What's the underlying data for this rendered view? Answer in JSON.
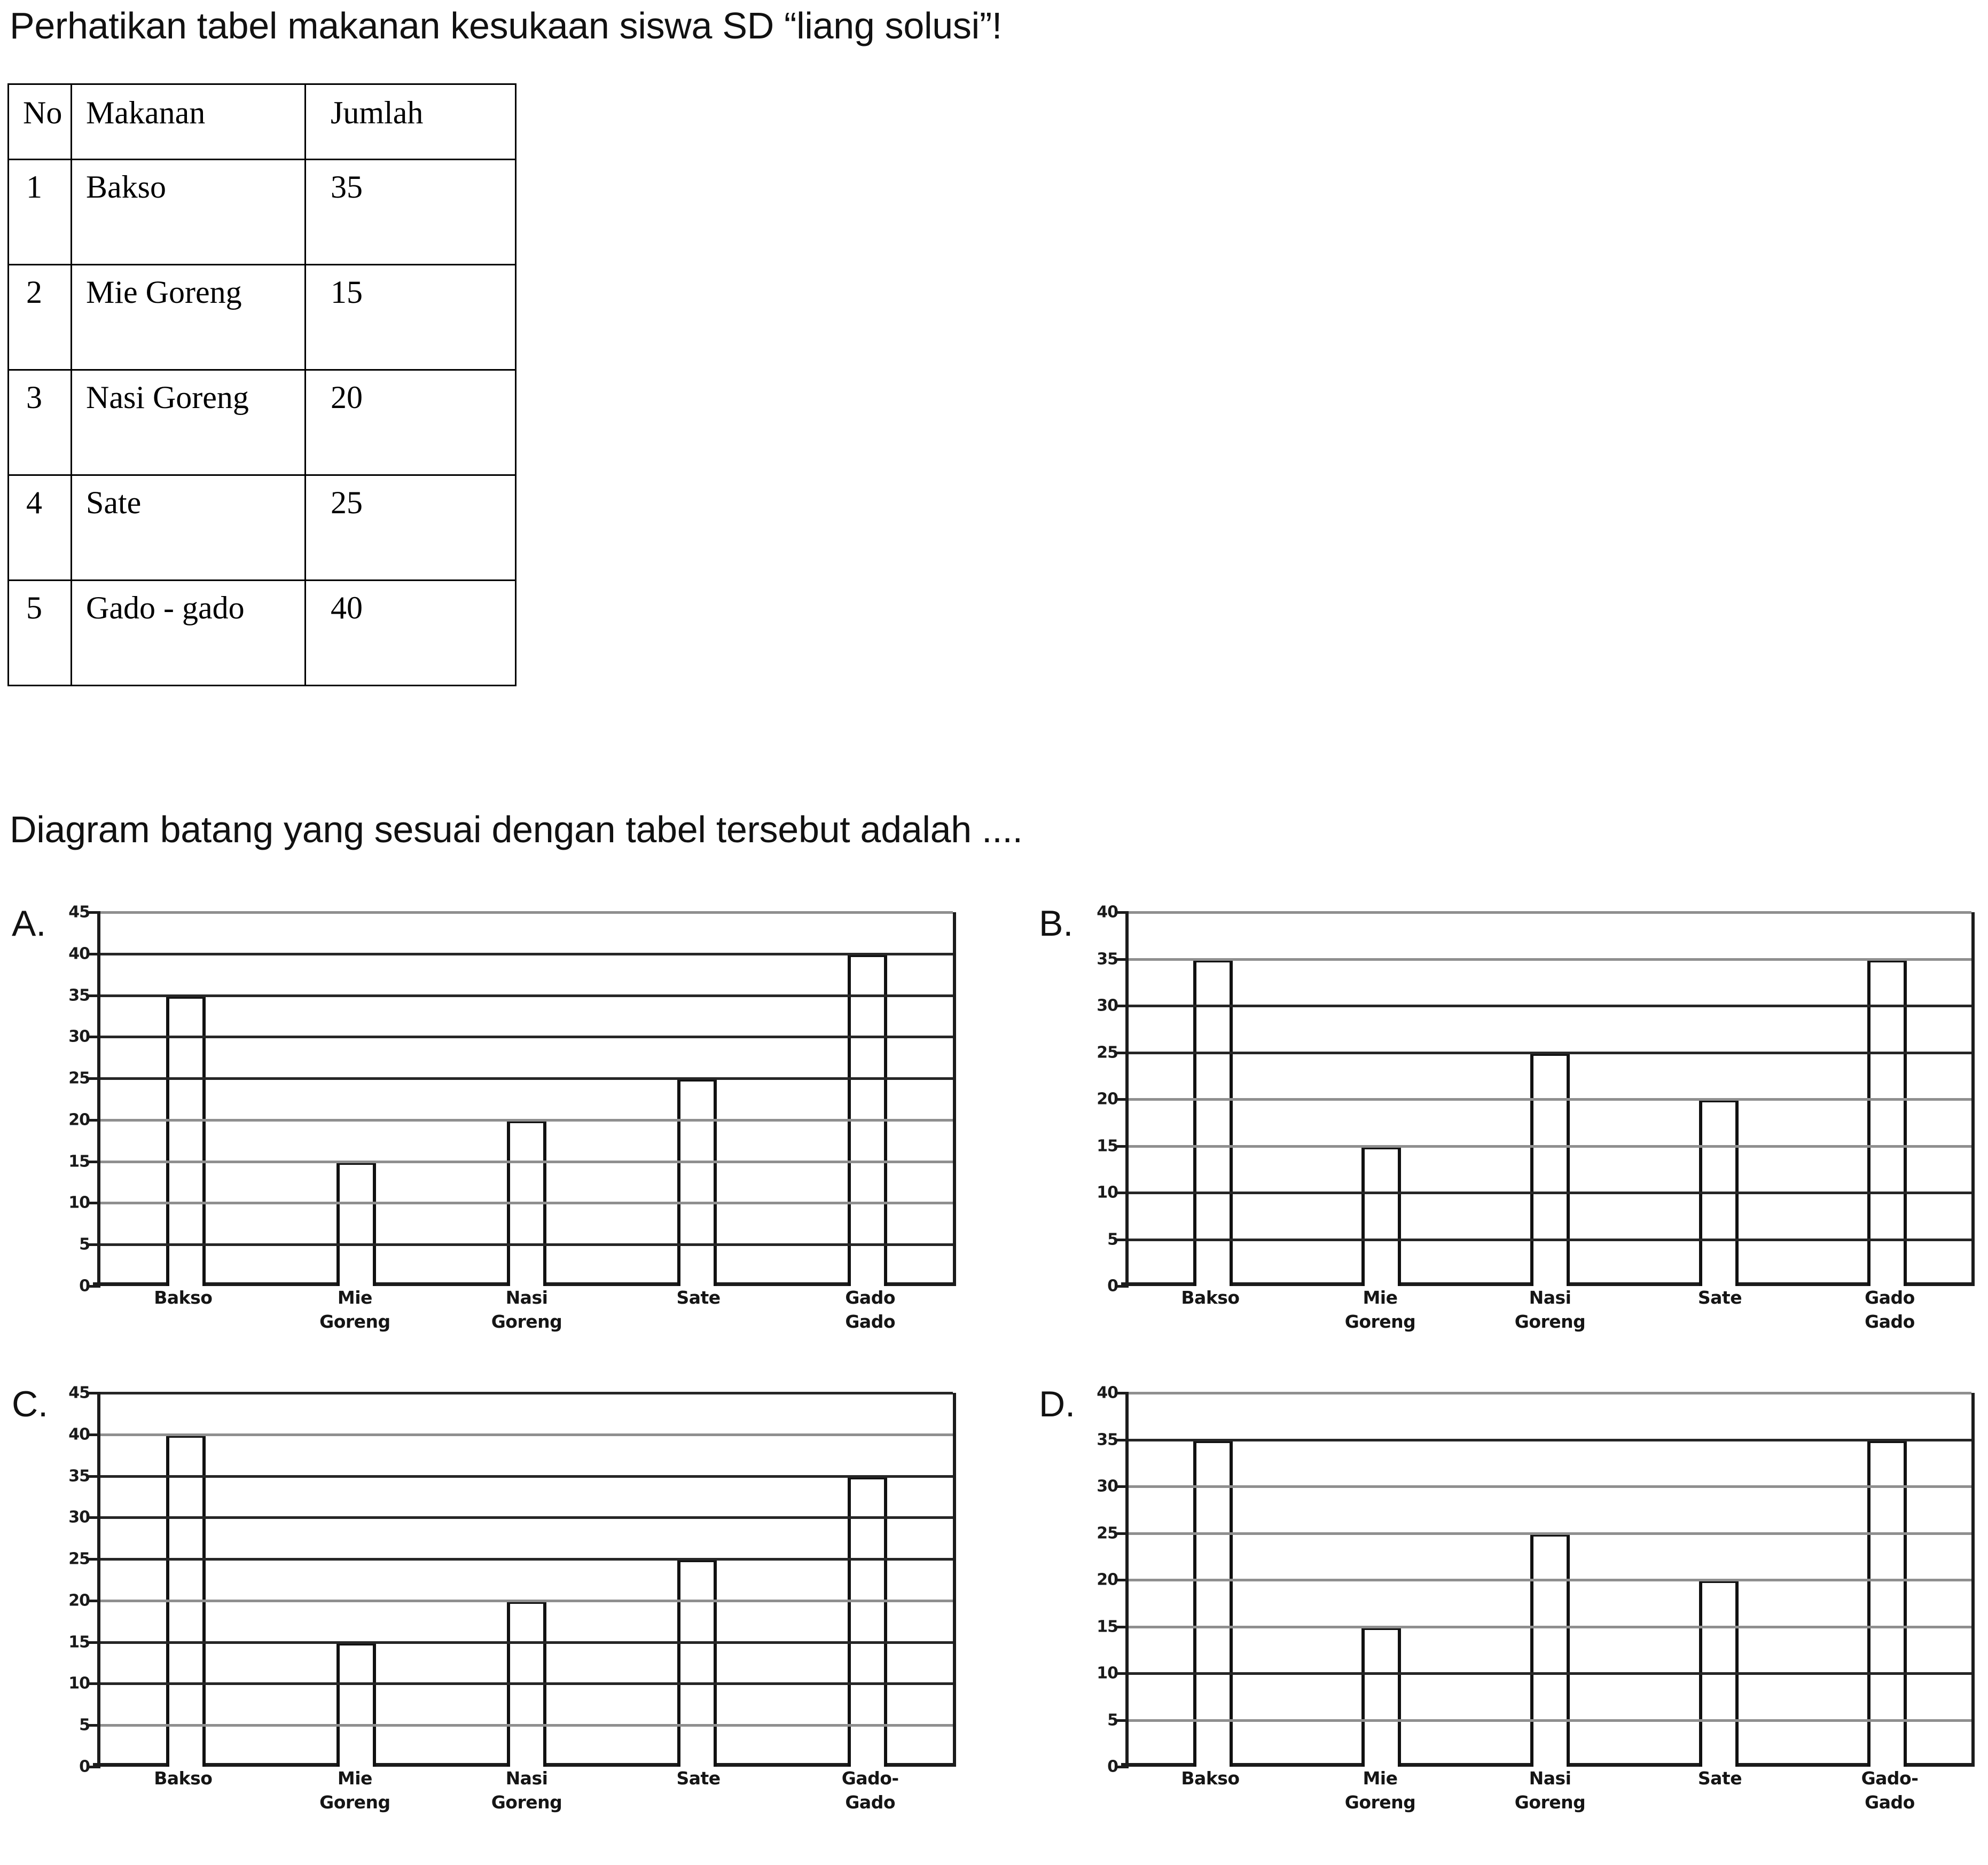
{
  "prompt": {
    "intro": "Perhatikan tabel makanan kesukaan siswa SD “liang solusi”!",
    "question": "Diagram batang yang sesuai dengan tabel tersebut adalah ...."
  },
  "table": {
    "headers": [
      "No",
      "Makanan",
      "Jumlah"
    ],
    "rows": [
      [
        "1",
        "Bakso",
        "35"
      ],
      [
        "2",
        "Mie Goreng",
        "15"
      ],
      [
        "3",
        "Nasi Goreng",
        "20"
      ],
      [
        "4",
        "Sate",
        "25"
      ],
      [
        "5",
        "Gado - gado",
        "40"
      ]
    ]
  },
  "options": [
    {
      "letter": "A."
    },
    {
      "letter": "B."
    },
    {
      "letter": "C."
    },
    {
      "letter": "D."
    }
  ],
  "chart_data": [
    {
      "id": "A",
      "type": "bar",
      "title": "",
      "xlabel": "",
      "ylabel": "",
      "categories": [
        "Bakso",
        "Mie Goreng",
        "Nasi Goreng",
        "Sate",
        "Gado Gado"
      ],
      "category_lines": [
        [
          "Bakso"
        ],
        [
          "Mie",
          "Goreng"
        ],
        [
          "Nasi",
          "Goreng"
        ],
        [
          "Sate"
        ],
        [
          "Gado",
          "Gado"
        ]
      ],
      "values": [
        35,
        15,
        20,
        25,
        40
      ],
      "ylim": [
        0,
        45
      ],
      "yticks": [
        0,
        5,
        10,
        15,
        20,
        25,
        30,
        35,
        40,
        45
      ],
      "grid": true,
      "legend": "none"
    },
    {
      "id": "B",
      "type": "bar",
      "title": "",
      "xlabel": "",
      "ylabel": "",
      "categories": [
        "Bakso",
        "Mie Goreng",
        "Nasi Goreng",
        "Sate",
        "Gado Gado"
      ],
      "category_lines": [
        [
          "Bakso"
        ],
        [
          "Mie",
          "Goreng"
        ],
        [
          "Nasi",
          "Goreng"
        ],
        [
          "Sate"
        ],
        [
          "Gado",
          "Gado"
        ]
      ],
      "values": [
        35,
        15,
        25,
        20,
        35
      ],
      "ylim": [
        0,
        40
      ],
      "yticks": [
        0,
        5,
        10,
        15,
        20,
        25,
        30,
        35,
        40
      ],
      "grid": true,
      "legend": "none"
    },
    {
      "id": "C",
      "type": "bar",
      "title": "",
      "xlabel": "",
      "ylabel": "",
      "categories": [
        "Bakso",
        "Mie Goreng",
        "Nasi Goreng",
        "Sate",
        "Gado-Gado"
      ],
      "category_lines": [
        [
          "Bakso"
        ],
        [
          "Mie",
          "Goreng"
        ],
        [
          "Nasi",
          "Goreng"
        ],
        [
          "Sate"
        ],
        [
          "Gado-",
          "Gado"
        ]
      ],
      "values": [
        40,
        15,
        20,
        25,
        35
      ],
      "ylim": [
        0,
        45
      ],
      "yticks": [
        0,
        5,
        10,
        15,
        20,
        25,
        30,
        35,
        40,
        45
      ],
      "grid": true,
      "legend": "none"
    },
    {
      "id": "D",
      "type": "bar",
      "title": "",
      "xlabel": "",
      "ylabel": "",
      "categories": [
        "Bakso",
        "Mie Goreng",
        "Nasi Goreng",
        "Sate",
        "Gado-Gado"
      ],
      "category_lines": [
        [
          "Bakso"
        ],
        [
          "Mie",
          "Goreng"
        ],
        [
          "Nasi",
          "Goreng"
        ],
        [
          "Sate"
        ],
        [
          "Gado-",
          "Gado"
        ]
      ],
      "values": [
        35,
        15,
        25,
        20,
        35
      ],
      "ylim": [
        0,
        40
      ],
      "yticks": [
        0,
        5,
        10,
        15,
        20,
        25,
        30,
        35,
        40
      ],
      "grid": true,
      "legend": "none"
    }
  ]
}
